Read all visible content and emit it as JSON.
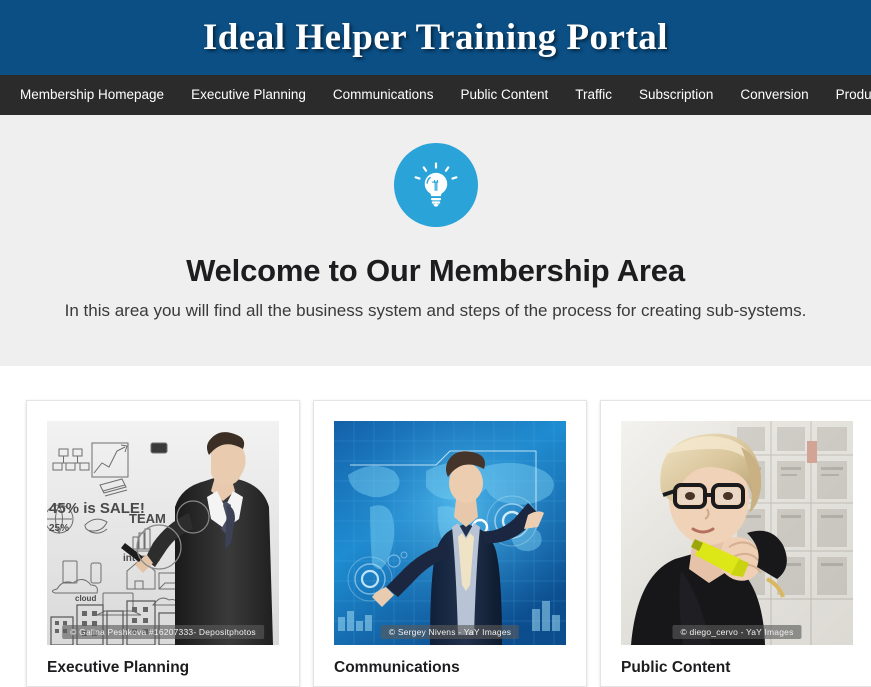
{
  "header": {
    "title": "Ideal Helper Training Portal",
    "background_color": "#0b4f85"
  },
  "nav": {
    "background_color": "#2b2b2b",
    "items": [
      {
        "label": "Membership Homepage"
      },
      {
        "label": "Executive Planning"
      },
      {
        "label": "Communications"
      },
      {
        "label": "Public Content"
      },
      {
        "label": "Traffic"
      },
      {
        "label": "Subscription"
      },
      {
        "label": "Conversion"
      },
      {
        "label": "Product & delivery"
      }
    ]
  },
  "hero": {
    "icon": "lightbulb-icon",
    "icon_circle_color": "#29a3d8",
    "background_color": "#efefef",
    "title": "Welcome to Our Membership Area",
    "subtitle": "In this area you will find all the business system and steps of the process for creating sub-systems."
  },
  "cards": [
    {
      "title": "Executive Planning",
      "image_name": "businessman-drawing-diagrams-photo",
      "credit": "© Galina Peshkova #16207333- Depositphotos"
    },
    {
      "title": "Communications",
      "image_name": "businessman-touchscreen-world-map-photo",
      "credit": "© Sergey Nivens - YaY Images"
    },
    {
      "title": "Public Content",
      "image_name": "woman-glasses-highlighter-newspapers-photo",
      "credit": "© diego_cervo - YaY Images"
    }
  ]
}
